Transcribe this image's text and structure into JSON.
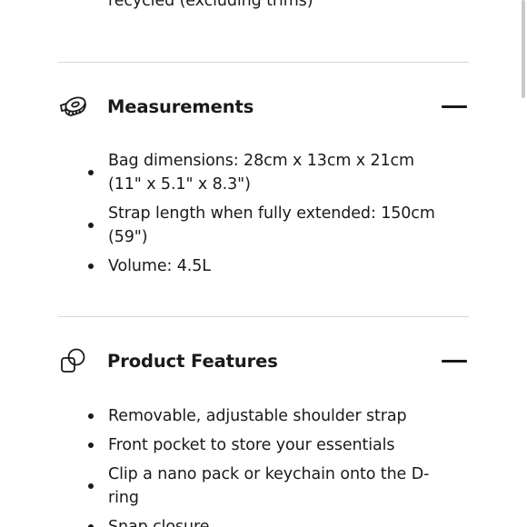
{
  "top_list": {
    "items": [
      "recycled (excluding trims)"
    ]
  },
  "measurements": {
    "title": "Measurements",
    "icon": "measuring-tape-icon",
    "toggle_icon": "collapse-minus-icon",
    "items": [
      "Bag dimensions: 28cm x 13cm x 21cm (11\" x 5.1\" x 8.3\")",
      "Strap length when fully extended: 150cm (59\")",
      "Volume: 4.5L"
    ]
  },
  "product_features": {
    "title": "Product Features",
    "icon": "overlapping-shapes-icon",
    "toggle_icon": "collapse-minus-icon",
    "items": [
      "Removable, adjustable shoulder strap",
      "Front pocket to store your essentials",
      "Clip a nano pack or keychain onto the D-ring",
      "Snap closure"
    ]
  },
  "colors": {
    "text": "#1a1a1a",
    "divider": "#d8d8d8",
    "background": "#ffffff"
  }
}
